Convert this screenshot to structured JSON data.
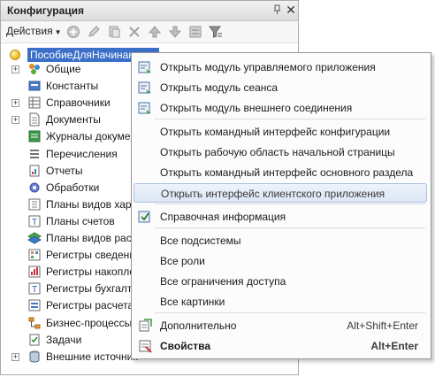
{
  "panel": {
    "title": "Конфигурация",
    "pin_glyph": "▫",
    "close_glyph": "✕",
    "actions_label": "Действия"
  },
  "tree": {
    "root": "ПособиеДляНачинающих",
    "items": [
      {
        "label": "Общие",
        "icon": "common-icon",
        "expandable": true
      },
      {
        "label": "Константы",
        "icon": "constants-icon",
        "expandable": false
      },
      {
        "label": "Справочники",
        "icon": "catalogs-icon",
        "expandable": true
      },
      {
        "label": "Документы",
        "icon": "documents-icon",
        "expandable": true
      },
      {
        "label": "Журналы документ",
        "icon": "journals-icon",
        "expandable": false
      },
      {
        "label": "Перечисления",
        "icon": "enums-icon",
        "expandable": false
      },
      {
        "label": "Отчеты",
        "icon": "reports-icon",
        "expandable": false
      },
      {
        "label": "Обработки",
        "icon": "dataprocessors-icon",
        "expandable": false
      },
      {
        "label": "Планы видов харак",
        "icon": "chart-of-characteristics-icon",
        "expandable": false
      },
      {
        "label": "Планы счетов",
        "icon": "chart-of-accounts-icon",
        "expandable": false
      },
      {
        "label": "Планы видов расче",
        "icon": "chart-of-calc-types-icon",
        "expandable": false
      },
      {
        "label": "Регистры сведени",
        "icon": "info-registers-icon",
        "expandable": false
      },
      {
        "label": "Регистры накопле",
        "icon": "accum-registers-icon",
        "expandable": false
      },
      {
        "label": "Регистры бухгалтер",
        "icon": "accounting-registers-icon",
        "expandable": false
      },
      {
        "label": "Регистры расчета",
        "icon": "calc-registers-icon",
        "expandable": false
      },
      {
        "label": "Бизнес-процессы",
        "icon": "business-processes-icon",
        "expandable": false
      },
      {
        "label": "Задачи",
        "icon": "tasks-icon",
        "expandable": false
      },
      {
        "label": "Внешние источник",
        "icon": "external-sources-icon",
        "expandable": true
      }
    ]
  },
  "menu": {
    "items": [
      {
        "label": "Открыть модуль управляемого приложения",
        "icon": "module-icon",
        "shortcut": ""
      },
      {
        "label": "Открыть модуль сеанса",
        "icon": "module-icon",
        "shortcut": ""
      },
      {
        "label": "Открыть модуль внешнего соединения",
        "icon": "module-icon",
        "shortcut": ""
      },
      {
        "label": "Открыть командный интерфейс конфигурации",
        "icon": "",
        "shortcut": ""
      },
      {
        "label": "Открыть рабочую область начальной страницы",
        "icon": "",
        "shortcut": ""
      },
      {
        "label": "Открыть командный интерфейс основного раздела",
        "icon": "",
        "shortcut": ""
      },
      {
        "label": "Открыть интерфейс клиентского приложения",
        "icon": "",
        "shortcut": "",
        "highlighted": true
      },
      {
        "label": "Справочная информация",
        "icon": "help-icon",
        "shortcut": ""
      },
      {
        "label": "Все подсистемы",
        "icon": "",
        "shortcut": ""
      },
      {
        "label": "Все роли",
        "icon": "",
        "shortcut": ""
      },
      {
        "label": "Все ограничения доступа",
        "icon": "",
        "shortcut": ""
      },
      {
        "label": "Все картинки",
        "icon": "",
        "shortcut": ""
      },
      {
        "label": "Дополнительно",
        "icon": "additional-icon",
        "shortcut": "Alt+Shift+Enter"
      },
      {
        "label": "Свойства",
        "icon": "properties-icon",
        "shortcut": "Alt+Enter",
        "bold": true
      }
    ]
  }
}
